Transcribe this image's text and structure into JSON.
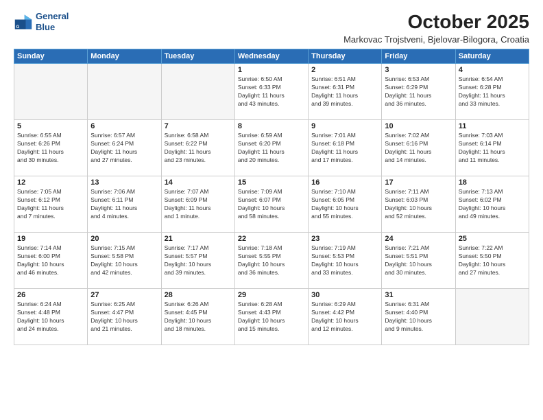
{
  "logo": {
    "line1": "General",
    "line2": "Blue"
  },
  "title": "October 2025",
  "subtitle": "Markovac Trojstveni, Bjelovar-Bilogora, Croatia",
  "days_of_week": [
    "Sunday",
    "Monday",
    "Tuesday",
    "Wednesday",
    "Thursday",
    "Friday",
    "Saturday"
  ],
  "weeks": [
    [
      {
        "day": "",
        "info": ""
      },
      {
        "day": "",
        "info": ""
      },
      {
        "day": "",
        "info": ""
      },
      {
        "day": "1",
        "info": "Sunrise: 6:50 AM\nSunset: 6:33 PM\nDaylight: 11 hours\nand 43 minutes."
      },
      {
        "day": "2",
        "info": "Sunrise: 6:51 AM\nSunset: 6:31 PM\nDaylight: 11 hours\nand 39 minutes."
      },
      {
        "day": "3",
        "info": "Sunrise: 6:53 AM\nSunset: 6:29 PM\nDaylight: 11 hours\nand 36 minutes."
      },
      {
        "day": "4",
        "info": "Sunrise: 6:54 AM\nSunset: 6:28 PM\nDaylight: 11 hours\nand 33 minutes."
      }
    ],
    [
      {
        "day": "5",
        "info": "Sunrise: 6:55 AM\nSunset: 6:26 PM\nDaylight: 11 hours\nand 30 minutes."
      },
      {
        "day": "6",
        "info": "Sunrise: 6:57 AM\nSunset: 6:24 PM\nDaylight: 11 hours\nand 27 minutes."
      },
      {
        "day": "7",
        "info": "Sunrise: 6:58 AM\nSunset: 6:22 PM\nDaylight: 11 hours\nand 23 minutes."
      },
      {
        "day": "8",
        "info": "Sunrise: 6:59 AM\nSunset: 6:20 PM\nDaylight: 11 hours\nand 20 minutes."
      },
      {
        "day": "9",
        "info": "Sunrise: 7:01 AM\nSunset: 6:18 PM\nDaylight: 11 hours\nand 17 minutes."
      },
      {
        "day": "10",
        "info": "Sunrise: 7:02 AM\nSunset: 6:16 PM\nDaylight: 11 hours\nand 14 minutes."
      },
      {
        "day": "11",
        "info": "Sunrise: 7:03 AM\nSunset: 6:14 PM\nDaylight: 11 hours\nand 11 minutes."
      }
    ],
    [
      {
        "day": "12",
        "info": "Sunrise: 7:05 AM\nSunset: 6:12 PM\nDaylight: 11 hours\nand 7 minutes."
      },
      {
        "day": "13",
        "info": "Sunrise: 7:06 AM\nSunset: 6:11 PM\nDaylight: 11 hours\nand 4 minutes."
      },
      {
        "day": "14",
        "info": "Sunrise: 7:07 AM\nSunset: 6:09 PM\nDaylight: 11 hours\nand 1 minute."
      },
      {
        "day": "15",
        "info": "Sunrise: 7:09 AM\nSunset: 6:07 PM\nDaylight: 10 hours\nand 58 minutes."
      },
      {
        "day": "16",
        "info": "Sunrise: 7:10 AM\nSunset: 6:05 PM\nDaylight: 10 hours\nand 55 minutes."
      },
      {
        "day": "17",
        "info": "Sunrise: 7:11 AM\nSunset: 6:03 PM\nDaylight: 10 hours\nand 52 minutes."
      },
      {
        "day": "18",
        "info": "Sunrise: 7:13 AM\nSunset: 6:02 PM\nDaylight: 10 hours\nand 49 minutes."
      }
    ],
    [
      {
        "day": "19",
        "info": "Sunrise: 7:14 AM\nSunset: 6:00 PM\nDaylight: 10 hours\nand 46 minutes."
      },
      {
        "day": "20",
        "info": "Sunrise: 7:15 AM\nSunset: 5:58 PM\nDaylight: 10 hours\nand 42 minutes."
      },
      {
        "day": "21",
        "info": "Sunrise: 7:17 AM\nSunset: 5:57 PM\nDaylight: 10 hours\nand 39 minutes."
      },
      {
        "day": "22",
        "info": "Sunrise: 7:18 AM\nSunset: 5:55 PM\nDaylight: 10 hours\nand 36 minutes."
      },
      {
        "day": "23",
        "info": "Sunrise: 7:19 AM\nSunset: 5:53 PM\nDaylight: 10 hours\nand 33 minutes."
      },
      {
        "day": "24",
        "info": "Sunrise: 7:21 AM\nSunset: 5:51 PM\nDaylight: 10 hours\nand 30 minutes."
      },
      {
        "day": "25",
        "info": "Sunrise: 7:22 AM\nSunset: 5:50 PM\nDaylight: 10 hours\nand 27 minutes."
      }
    ],
    [
      {
        "day": "26",
        "info": "Sunrise: 6:24 AM\nSunset: 4:48 PM\nDaylight: 10 hours\nand 24 minutes."
      },
      {
        "day": "27",
        "info": "Sunrise: 6:25 AM\nSunset: 4:47 PM\nDaylight: 10 hours\nand 21 minutes."
      },
      {
        "day": "28",
        "info": "Sunrise: 6:26 AM\nSunset: 4:45 PM\nDaylight: 10 hours\nand 18 minutes."
      },
      {
        "day": "29",
        "info": "Sunrise: 6:28 AM\nSunset: 4:43 PM\nDaylight: 10 hours\nand 15 minutes."
      },
      {
        "day": "30",
        "info": "Sunrise: 6:29 AM\nSunset: 4:42 PM\nDaylight: 10 hours\nand 12 minutes."
      },
      {
        "day": "31",
        "info": "Sunrise: 6:31 AM\nSunset: 4:40 PM\nDaylight: 10 hours\nand 9 minutes."
      },
      {
        "day": "",
        "info": ""
      }
    ]
  ]
}
